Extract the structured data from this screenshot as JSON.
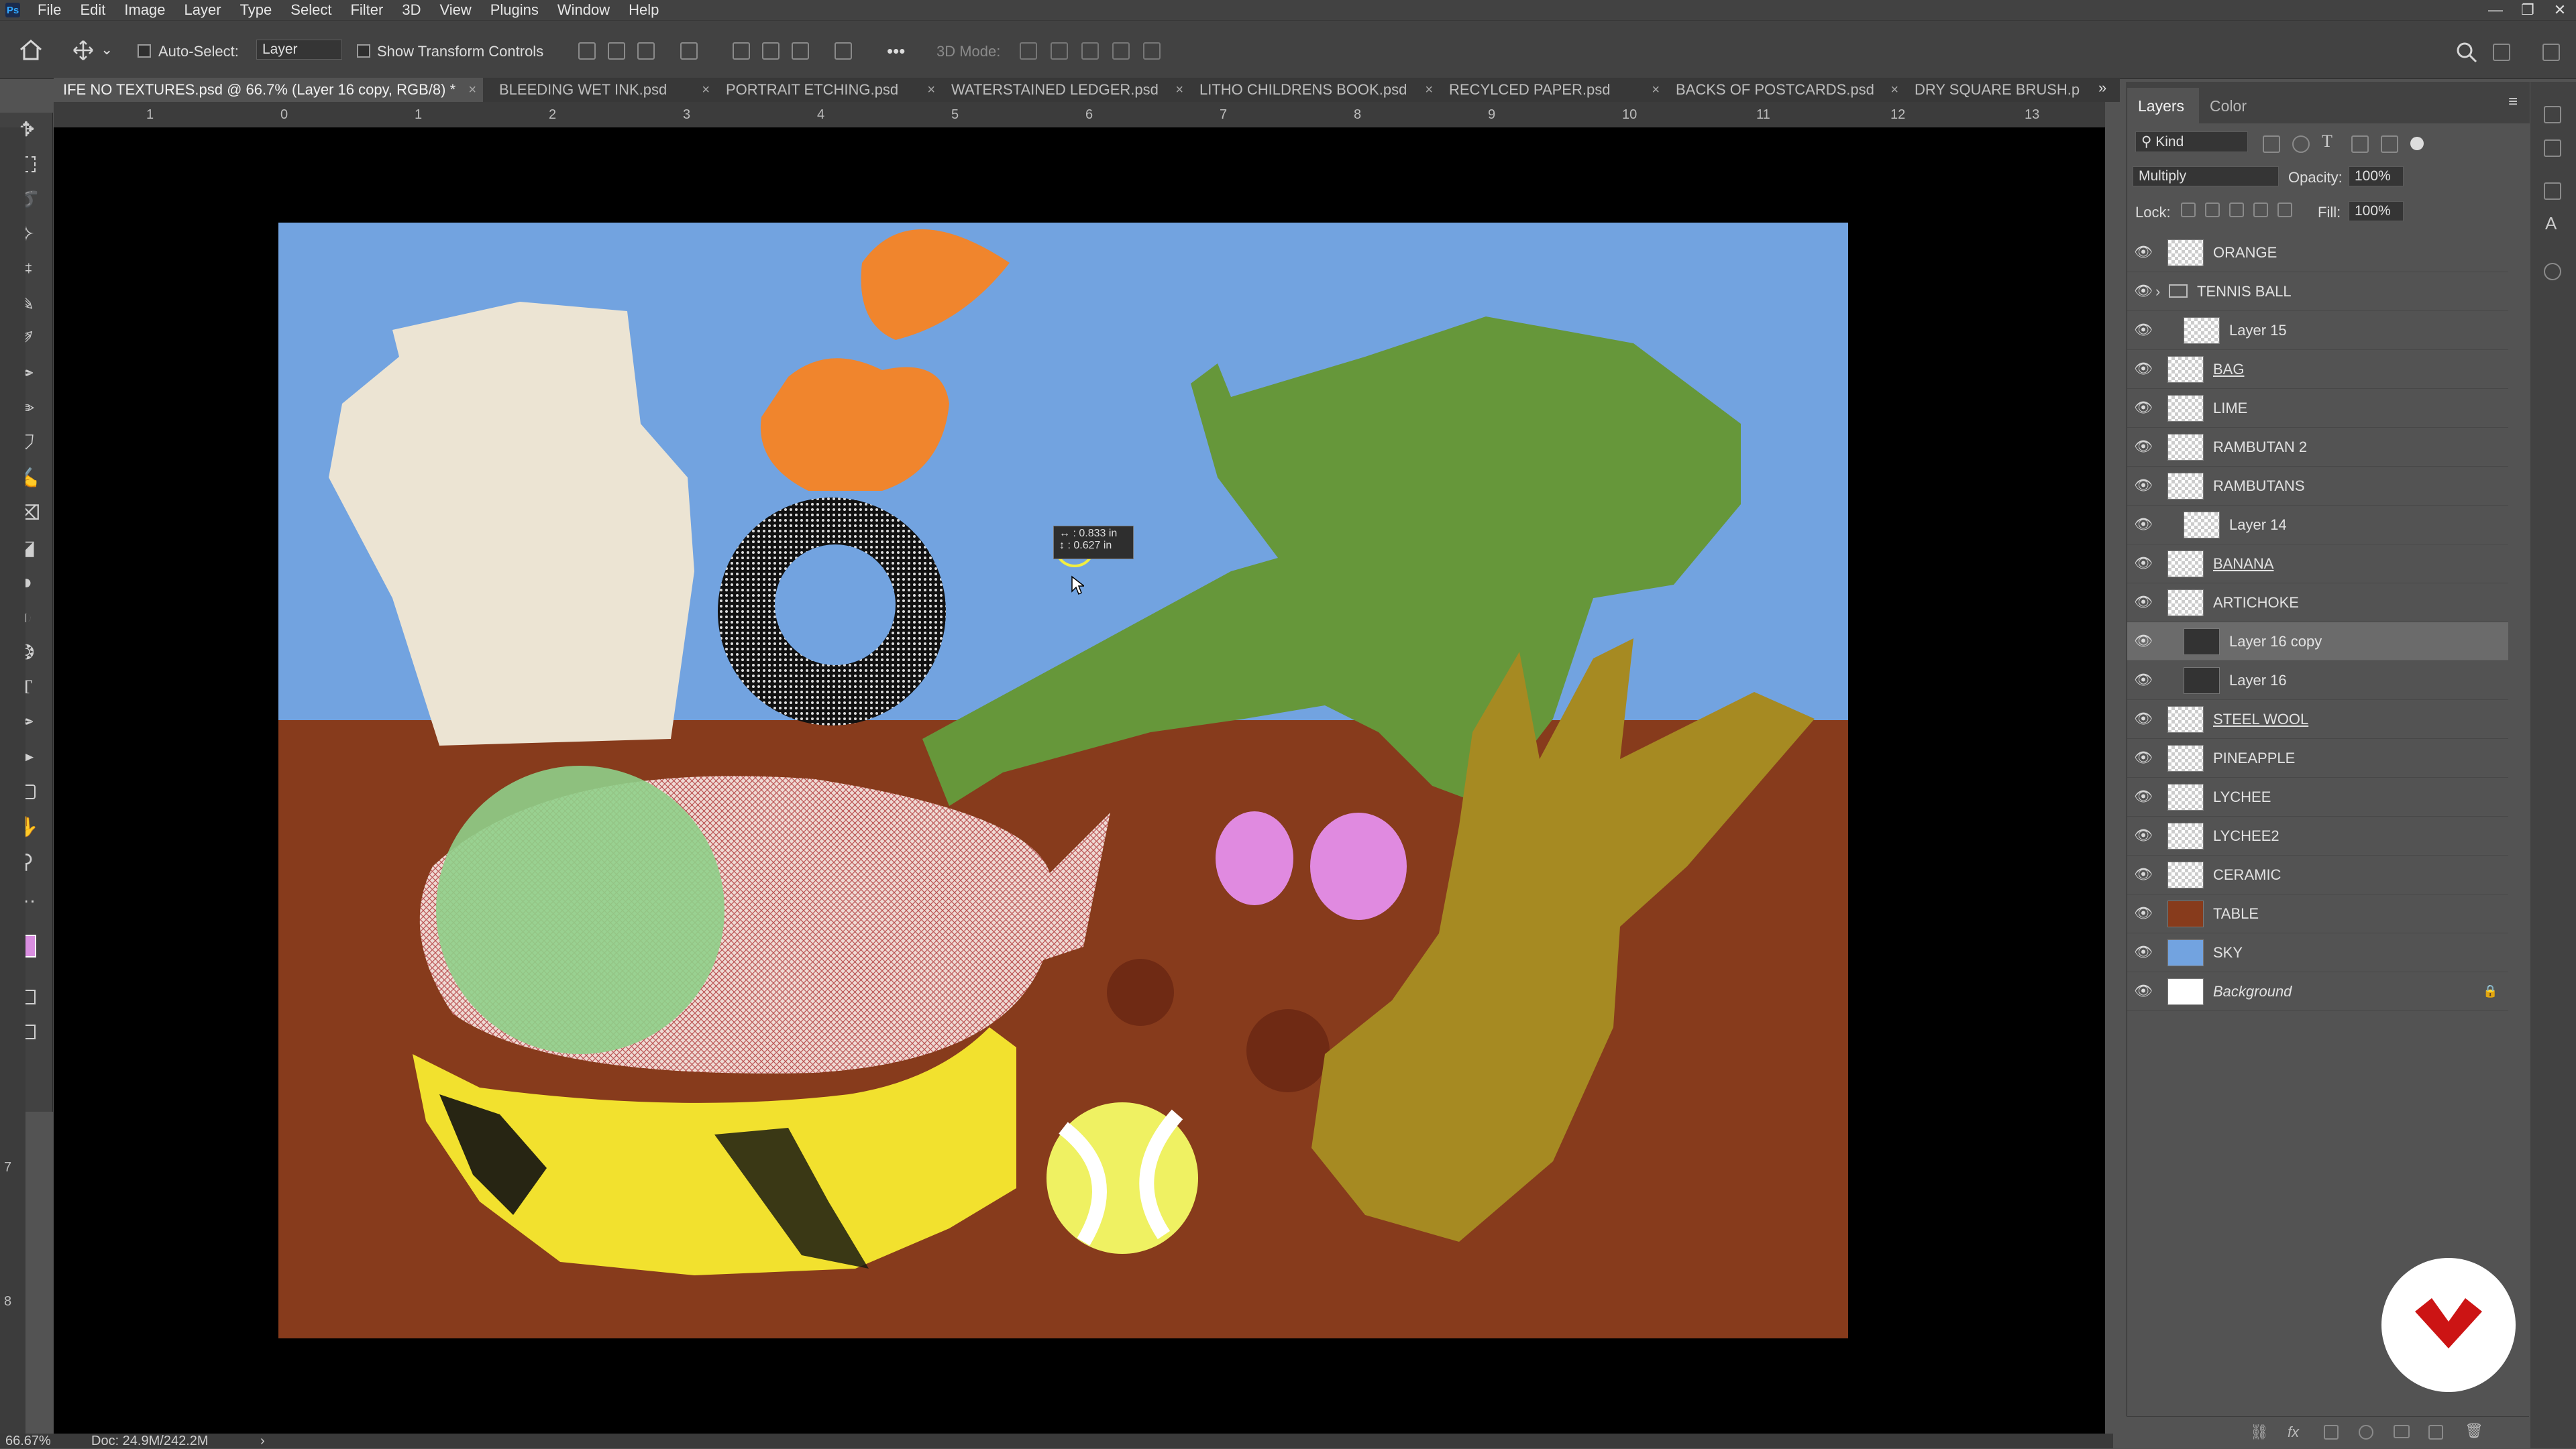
{
  "menubar": {
    "items": [
      "File",
      "Edit",
      "Image",
      "Layer",
      "Type",
      "Select",
      "Filter",
      "3D",
      "View",
      "Plugins",
      "Window",
      "Help"
    ],
    "window_controls": [
      "—",
      "❐",
      "✕"
    ]
  },
  "options": {
    "auto_select_label": "Auto-Select:",
    "auto_select_value": "Layer",
    "show_transform_label": "Show Transform Controls",
    "mode_3d_label": "3D Mode:",
    "more_label": "•••"
  },
  "tabs": [
    {
      "label": "IFE NO TEXTURES.psd @ 66.7% (Layer 16 copy, RGB/8) *",
      "active": true
    },
    {
      "label": "BLEEDING WET INK.psd",
      "active": false
    },
    {
      "label": "PORTRAIT ETCHING.psd",
      "active": false
    },
    {
      "label": "WATERSTAINED LEDGER.psd",
      "active": false
    },
    {
      "label": "LITHO CHILDRENS BOOK.psd",
      "active": false
    },
    {
      "label": "RECYLCED PAPER.psd",
      "active": false
    },
    {
      "label": "BACKS OF POSTCARDS.psd",
      "active": false
    },
    {
      "label": "DRY SQUARE BRUSH.p",
      "active": false
    }
  ],
  "ruler": {
    "h_labels": [
      "1",
      "0",
      "1",
      "2",
      "3",
      "4",
      "5",
      "6",
      "7",
      "8",
      "9",
      "10",
      "11",
      "12",
      "13"
    ],
    "v_labels": [
      "7",
      "8"
    ]
  },
  "canvas_tooltip": {
    "line1": "0.833 in",
    "line2": "0.627 in"
  },
  "status": {
    "zoom": "66.67%",
    "doc": "Doc: 24.9M/242.2M",
    "arrow": "›"
  },
  "layers_panel": {
    "tabs": [
      "Layers",
      "Color"
    ],
    "filter_kind": "Kind",
    "blend_mode": "Multiply",
    "opacity_label": "Opacity:",
    "opacity_value": "100%",
    "lock_label": "Lock:",
    "fill_label": "Fill:",
    "fill_value": "100%",
    "layers": [
      {
        "name": "ORANGE",
        "thumb": "checker"
      },
      {
        "name": "TENNIS BALL",
        "thumb": "folder"
      },
      {
        "name": "Layer 15",
        "thumb": "checker"
      },
      {
        "name": "BAG",
        "thumb": "checker"
      },
      {
        "name": "LIME",
        "thumb": "checker"
      },
      {
        "name": "RAMBUTAN 2",
        "thumb": "checker"
      },
      {
        "name": "RAMBUTANS",
        "thumb": "checker"
      },
      {
        "name": "Layer 14",
        "thumb": "checker"
      },
      {
        "name": "BANANA",
        "thumb": "checker"
      },
      {
        "name": "ARTICHOKE",
        "thumb": "checker"
      },
      {
        "name": "Layer 16 copy",
        "thumb": "dark",
        "selected": true
      },
      {
        "name": "Layer 16",
        "thumb": "dark"
      },
      {
        "name": "STEEL WOOL",
        "thumb": "checker"
      },
      {
        "name": "PINEAPPLE",
        "thumb": "checker"
      },
      {
        "name": "LYCHEE",
        "thumb": "checker"
      },
      {
        "name": "LYCHEE2",
        "thumb": "checker"
      },
      {
        "name": "CERAMIC",
        "thumb": "checker"
      },
      {
        "name": "TABLE",
        "thumb": "table"
      },
      {
        "name": "SKY",
        "thumb": "sky"
      },
      {
        "name": "Background",
        "thumb": "white"
      }
    ]
  },
  "colors": {
    "sky": "#72a3e0",
    "table": "#873b1c",
    "ceramic": "#ece4d3",
    "orange": "#f0852d",
    "artichoke": "#66973a",
    "lychee": "#e08ae0",
    "rambutan": "#6f2a14",
    "pineapple": "#a68a22",
    "bag": "#e3c8c0",
    "lime": "#8fcf8a",
    "banana": "#f2e12e",
    "tennis": "#eff162"
  }
}
